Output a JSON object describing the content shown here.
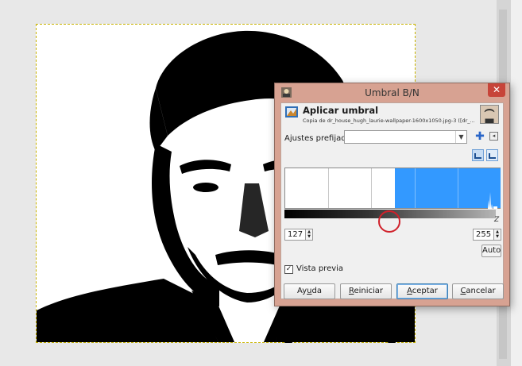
{
  "dialog": {
    "title": "Umbral B/N",
    "close_glyph": "✕",
    "header": {
      "title": "Aplicar umbral",
      "subtitle": "Copia de dr_house_hugh_laurie-wallpaper-1600x1050.jpg-3 ([dr_..."
    },
    "presets": {
      "label": "Ajustes prefijados:",
      "value": "",
      "add_glyph": "✚",
      "menu_glyph": "◂"
    },
    "histogram": {
      "channel_low": 127,
      "channel_high": 255,
      "selection_color": "#3399ff",
      "gradient_end_letter": "Z"
    },
    "threshold": {
      "low_value": "127",
      "high_value": "255"
    },
    "auto_label": "Auto",
    "preview": {
      "label": "Vista previa",
      "checked": true,
      "check_glyph": "✓"
    },
    "buttons": {
      "help": {
        "before": "Ay",
        "mnemonic": "u",
        "after": "da"
      },
      "reset": {
        "before": "",
        "mnemonic": "R",
        "after": "einiciar"
      },
      "accept": {
        "before": "",
        "mnemonic": "A",
        "after": "ceptar"
      },
      "cancel": {
        "before": "",
        "mnemonic": "C",
        "after": "ancelar"
      }
    }
  },
  "colors": {
    "dialog_border": "#d7a292",
    "close_button": "#c74439",
    "highlight": "#d0202a"
  },
  "icons": [
    "gimp-app-icon",
    "threshold-tool-icon",
    "image-thumbnail",
    "chevron-down-icon",
    "add-icon",
    "menu-arrow-icon",
    "linear-histogram-icon",
    "log-histogram-icon"
  ]
}
